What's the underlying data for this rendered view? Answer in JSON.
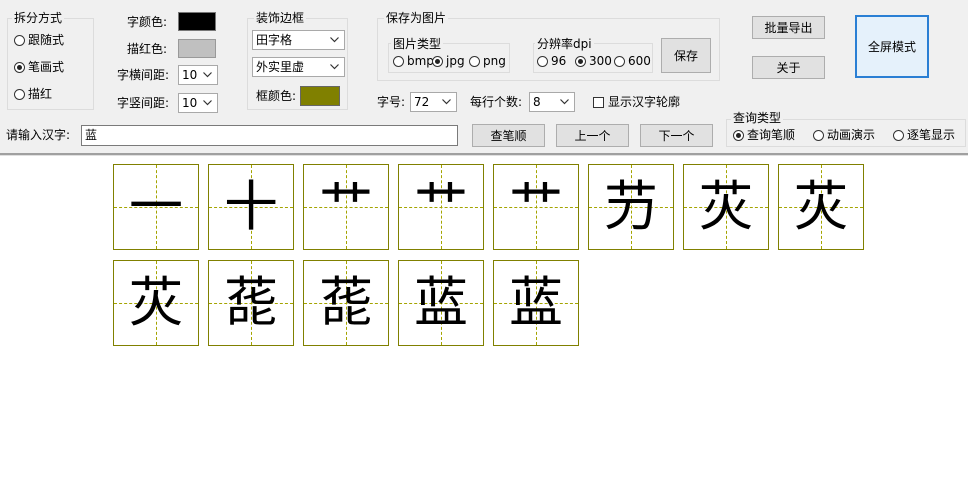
{
  "split_mode": {
    "title": "拆分方式",
    "options": [
      {
        "label": "跟随式",
        "selected": false
      },
      {
        "label": "笔画式",
        "selected": true
      },
      {
        "label": "描红",
        "selected": false
      }
    ]
  },
  "style": {
    "char_color_label": "字颜色:",
    "char_color": "#000000",
    "trace_color_label": "描红色:",
    "trace_color": "#c0c0c0",
    "h_spacing_label": "字横间距:",
    "h_spacing_value": "10",
    "v_spacing_label": "字竖间距:",
    "v_spacing_value": "10"
  },
  "border": {
    "title": "装饰边框",
    "grid_type": "田字格",
    "line_style": "外实里虚",
    "frame_color_label": "框颜色:",
    "frame_color": "#808000"
  },
  "save": {
    "title": "保存为图片",
    "img_type_title": "图片类型",
    "img_types": [
      {
        "label": "bmp",
        "selected": false
      },
      {
        "label": "jpg",
        "selected": true
      },
      {
        "label": "png",
        "selected": false
      }
    ],
    "dpi_title": "分辨率dpi",
    "dpis": [
      {
        "label": "96",
        "selected": false
      },
      {
        "label": "300",
        "selected": true
      },
      {
        "label": "600",
        "selected": false
      }
    ],
    "save_button": "保存"
  },
  "font_size_label": "字号:",
  "font_size_value": "72",
  "per_row_label": "每行个数:",
  "per_row_value": "8",
  "show_outline_label": "显示汉字轮廓",
  "show_outline_checked": false,
  "batch_export_button": "批量导出",
  "about_button": "关于",
  "fullscreen_button": "全屏模式",
  "input_label": "请输入汉字:",
  "input_value": "蓝",
  "query_button": "查笔顺",
  "prev_button": "上一个",
  "next_button": "下一个",
  "query_type": {
    "title": "查询类型",
    "options": [
      {
        "label": "查询笔顺",
        "selected": true
      },
      {
        "label": "动画演示",
        "selected": false
      },
      {
        "label": "逐笔显示",
        "selected": false
      }
    ]
  },
  "stroke_steps": [
    "一",
    "十",
    "艹",
    "艹",
    "艹",
    "芀",
    "苂",
    "苂",
    "苂",
    "蒊",
    "蒊",
    "蓝",
    "蓝"
  ]
}
